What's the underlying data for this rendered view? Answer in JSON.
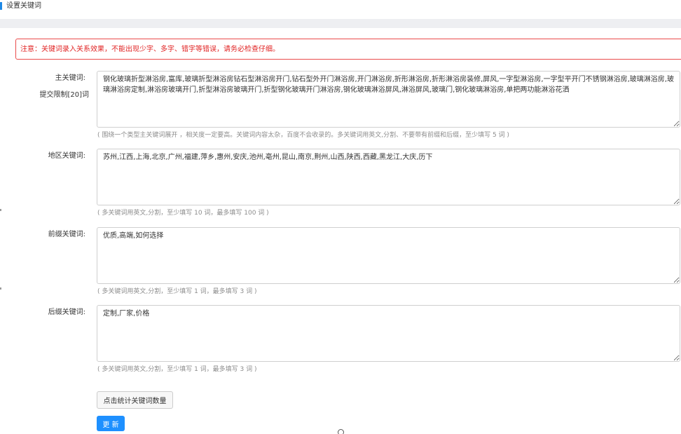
{
  "header": {
    "title": "设置关键词"
  },
  "notice": {
    "text": "注意：关键词录入关系效果，不能出现少字、多字、错字等错误，请务必检查仔细。"
  },
  "fields": {
    "main": {
      "label": "主关键词:",
      "sublabel": "提交限制[20]词",
      "value": "钢化玻璃折型淋浴房,富库,玻璃折型淋浴房钻石型淋浴房开门,钻石型外开门淋浴房,开门淋浴房,折形淋浴房,折形淋浴房装修,屏风,一字型淋浴房,一字型平开门不锈钢淋浴房,玻璃淋浴房,玻璃淋浴房定制,淋浴房玻璃开门,折型淋浴房玻璃开门,折型钢化玻璃开门淋浴房,钢化玻璃淋浴屏风,淋浴屏风,玻璃门,钢化玻璃淋浴房,单把两功能淋浴花洒",
      "hint": "( 围绕一个类型主关键词展开 ，相关度一定要高。关键词内容太杂，百度不会收录的。多关键词用英文,分割、不要带有前缀和后缀，至少填写 5 词 )"
    },
    "region": {
      "label": "地区关键词:",
      "value": "苏州,江西,上海,北京,广州,福建,萍乡,惠州,安庆,池州,亳州,昆山,南京,荆州,山西,陕西,西藏,黑龙江,大庆,历下",
      "hint": "( 多关键词用英文,分割，至少填写 10 词，最多填写 100 词 )"
    },
    "prefix": {
      "label": "前缀关键词:",
      "value": "优质,高端,如何选择",
      "hint": "( 多关键词用英文,分割，至少填写 1 词，最多填写 3 词 )"
    },
    "suffix": {
      "label": "后缀关键词:",
      "value": "定制,厂家,价格",
      "hint": "( 多关键词用英文,分割，至少填写 1 词，最多填写 3 词 )"
    }
  },
  "buttons": {
    "count_label": "点击统计关键词数量",
    "update_label": "更 新"
  },
  "colors": {
    "accent": "#1e90ff",
    "notice_border": "#ea4b4b",
    "notice_text": "#e12424",
    "hint_text": "#8c8c8c"
  },
  "icons": {
    "header_marker": "blue-bar-marker",
    "cursor": "circle-cursor"
  }
}
